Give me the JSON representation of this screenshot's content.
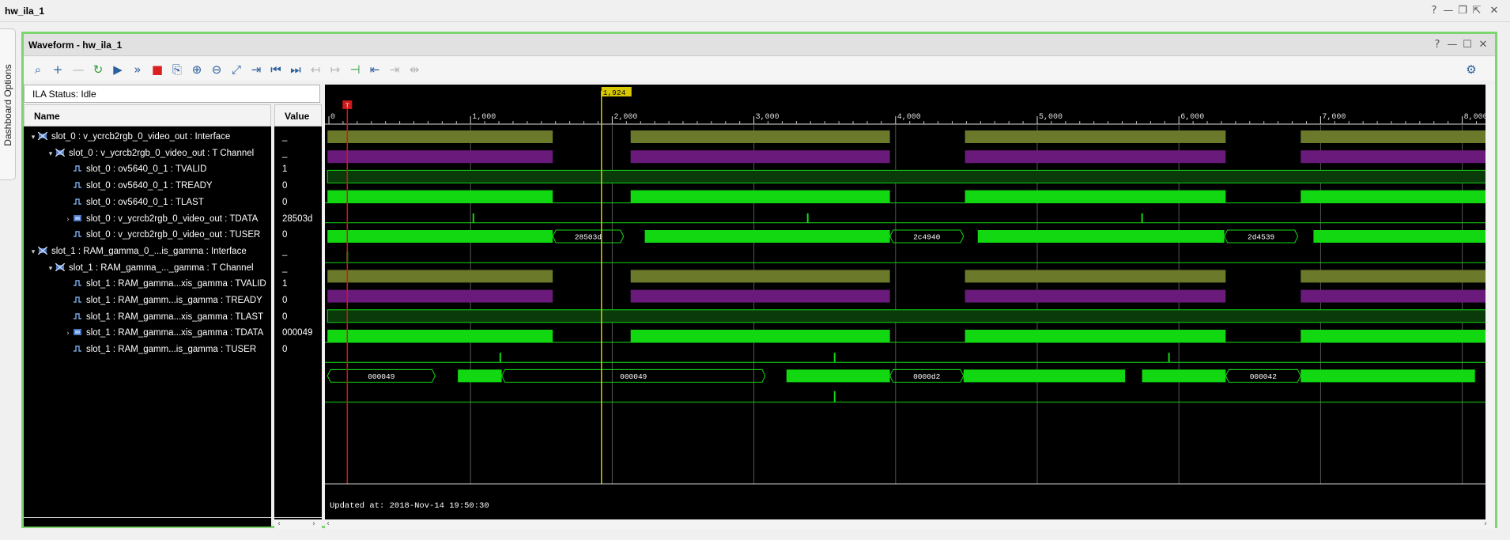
{
  "window": {
    "title": "hw_ila_1",
    "buttons": [
      "?",
      "—",
      "❐",
      "⇱",
      "✕"
    ]
  },
  "side_tab": {
    "label": "Dashboard Options"
  },
  "panel": {
    "title": "Waveform - hw_ila_1",
    "buttons": [
      "?",
      "—",
      "☐",
      "✕"
    ]
  },
  "toolbar": {
    "icons": [
      {
        "name": "search-icon",
        "glyph": "⌕",
        "state": "enabled"
      },
      {
        "name": "add-probe-icon",
        "glyph": "+",
        "state": "enabled"
      },
      {
        "name": "remove-probe-icon",
        "glyph": "—",
        "state": "disabled"
      },
      {
        "name": "run-trigger-immediate-icon",
        "glyph": "↻",
        "state": "green"
      },
      {
        "name": "run-trigger-icon",
        "glyph": "▶",
        "state": "enabled"
      },
      {
        "name": "auto-retrigger-icon",
        "glyph": "»",
        "state": "enabled"
      },
      {
        "name": "stop-trigger-icon",
        "glyph": "■",
        "state": "red"
      },
      {
        "name": "export-icon",
        "glyph": "⎘",
        "state": "enabled"
      },
      {
        "name": "zoom-in-icon",
        "glyph": "⊕",
        "state": "enabled"
      },
      {
        "name": "zoom-out-icon",
        "glyph": "⊖",
        "state": "enabled"
      },
      {
        "name": "zoom-fit-icon",
        "glyph": "⤢",
        "state": "enabled"
      },
      {
        "name": "go-to-cursor-icon",
        "glyph": "⇥",
        "state": "enabled"
      },
      {
        "name": "go-to-start-icon",
        "glyph": "⏮",
        "state": "enabled"
      },
      {
        "name": "go-to-end-icon",
        "glyph": "⏭",
        "state": "enabled"
      },
      {
        "name": "previous-transition-icon",
        "glyph": "↤",
        "state": "disabled"
      },
      {
        "name": "next-transition-icon",
        "glyph": "↦",
        "state": "disabled"
      },
      {
        "name": "add-marker-icon",
        "glyph": "⊣",
        "state": "green"
      },
      {
        "name": "previous-marker-icon",
        "glyph": "⇤",
        "state": "enabled"
      },
      {
        "name": "next-marker-icon",
        "glyph": "⇥",
        "state": "disabled"
      },
      {
        "name": "swap-cursors-icon",
        "glyph": "⇹",
        "state": "disabled"
      },
      {
        "name": "settings-gear-icon",
        "glyph": "⚙",
        "state": "enabled"
      }
    ]
  },
  "ila_status": "ILA Status:  Idle",
  "columns": {
    "name": "Name",
    "value": "Value"
  },
  "signals": [
    {
      "level": 0,
      "expander": "▾",
      "icon": "interface",
      "name": "slot_0 : v_ycrcb2rgb_0_video_out : Interface",
      "value": "_"
    },
    {
      "level": 1,
      "expander": "▾",
      "icon": "interface",
      "name": "slot_0 : v_ycrcb2rgb_0_video_out : T Channel",
      "value": "_"
    },
    {
      "level": 2,
      "expander": "",
      "icon": "bit",
      "name": "slot_0 : ov5640_0_1 : TVALID",
      "value": "1"
    },
    {
      "level": 2,
      "expander": "",
      "icon": "bit",
      "name": "slot_0 : ov5640_0_1 : TREADY",
      "value": "0"
    },
    {
      "level": 2,
      "expander": "",
      "icon": "bit",
      "name": "slot_0 : ov5640_0_1 : TLAST",
      "value": "0"
    },
    {
      "level": 2,
      "expander": "›",
      "icon": "bus",
      "name": "slot_0 : v_ycrcb2rgb_0_video_out : TDATA",
      "value": "28503d"
    },
    {
      "level": 2,
      "expander": "",
      "icon": "bit",
      "name": "slot_0 : v_ycrcb2rgb_0_video_out : TUSER",
      "value": "0"
    },
    {
      "level": 0,
      "expander": "▾",
      "icon": "interface",
      "name": "slot_1 : RAM_gamma_0_...is_gamma : Interface",
      "value": "_"
    },
    {
      "level": 1,
      "expander": "▾",
      "icon": "interface",
      "name": "slot_1 : RAM_gamma_..._gamma : T Channel",
      "value": "_"
    },
    {
      "level": 2,
      "expander": "",
      "icon": "bit",
      "name": "slot_1 : RAM_gamma...xis_gamma : TVALID",
      "value": "1"
    },
    {
      "level": 2,
      "expander": "",
      "icon": "bit",
      "name": "slot_1 : RAM_gamm...is_gamma : TREADY",
      "value": "0"
    },
    {
      "level": 2,
      "expander": "",
      "icon": "bit",
      "name": "slot_1 : RAM_gamma...xis_gamma : TLAST",
      "value": "0"
    },
    {
      "level": 2,
      "expander": "›",
      "icon": "bus",
      "name": "slot_1 : RAM_gamma...xis_gamma : TDATA",
      "value": "000049"
    },
    {
      "level": 2,
      "expander": "",
      "icon": "bit",
      "name": "slot_1 : RAM_gamm...is_gamma : TUSER",
      "value": "0"
    }
  ],
  "waveform": {
    "time_ruler": [
      "0",
      "1,000",
      "2,000",
      "3,000",
      "4,000",
      "5,000",
      "6,000",
      "7,000",
      "8,000"
    ],
    "cursor_label": "1,924",
    "trigger_marker": "T",
    "bus_labels": {
      "tdata0": [
        "28503d",
        "2c4940",
        "2d4539"
      ],
      "tdata1": [
        "000049",
        "000049",
        "0000d2",
        "000042"
      ]
    },
    "updated_at": "Updated at: 2018-Nov-14 19:50:30",
    "colors": {
      "background": "#000000",
      "interface": "#6b7a2a",
      "channel": "#6a1a7a",
      "signal": "#12d812",
      "tvalid_fill": "#0a3a0a",
      "grid": "#555555",
      "cursor": "#d8c800",
      "trigger": "#cc1a1a"
    }
  }
}
